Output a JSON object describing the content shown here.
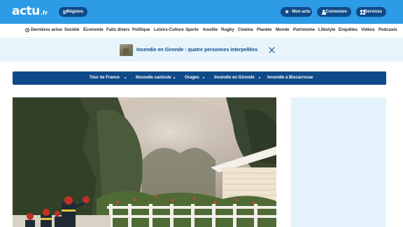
{
  "header": {
    "logo_main": "actu",
    "logo_suffix": ".fr",
    "regions_label": "Régions",
    "mon_actu_label": "Mon actu",
    "connexion_label": "Connexion",
    "services_label": "Services",
    "brand_color": "#2d9ce6",
    "pill_color": "#0f4a8a"
  },
  "nav": {
    "items": [
      "Dernières actus",
      "Société",
      "Économie",
      "Faits divers",
      "Politique",
      "Loisirs-Culture",
      "Sports",
      "Insolite",
      "Rugby",
      "Cinéma",
      "Planète",
      "Monde",
      "Patrimoine",
      "Lifestyle",
      "Enquêtes",
      "Vidéos",
      "Podcasts"
    ]
  },
  "banner": {
    "text": "Incendie en Gironde : quatre personnes interpellées",
    "background": "#e7f4fb"
  },
  "topics": {
    "items": [
      "Tour de France",
      "Nouvelle canicule",
      "Orages",
      "Incendie en Gironde",
      "Incendie à Biscarrosse"
    ]
  }
}
